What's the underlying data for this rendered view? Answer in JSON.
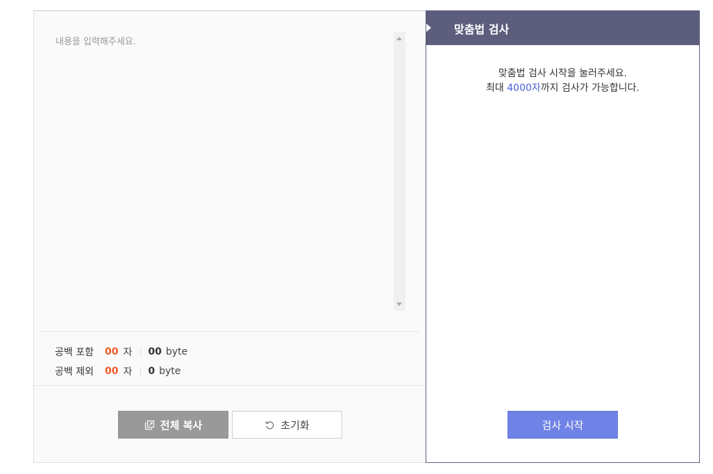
{
  "editor": {
    "placeholder": "내용을 입력해주세요."
  },
  "counts": {
    "with_spaces": {
      "label": "공백 포함",
      "chars": "00",
      "char_unit": "자",
      "bytes": "00",
      "byte_unit": "byte"
    },
    "without_spaces": {
      "label": "공백 제외",
      "chars": "00",
      "char_unit": "자",
      "bytes": "0",
      "byte_unit": "byte"
    }
  },
  "buttons": {
    "copy_all": "전체 복사",
    "reset": "초기화",
    "start_check": "검사 시작"
  },
  "checker": {
    "title": "맞춤법 검사",
    "guide_line1": "맞춤법 검사 시작을 눌러주세요.",
    "guide_line2_pre": "최대 ",
    "guide_line2_limit": "4000자",
    "guide_line2_post": "까지 검사가 가능합니다."
  },
  "colors": {
    "accent": "#5d5e7d",
    "count_highlight": "#f05a28",
    "limit_highlight": "#4a62d8",
    "start_button": "#6f82e6",
    "copy_button": "#999999"
  },
  "icons": {
    "copy": "copy-icon",
    "reset": "refresh-icon",
    "header": "triangle-right-icon"
  }
}
